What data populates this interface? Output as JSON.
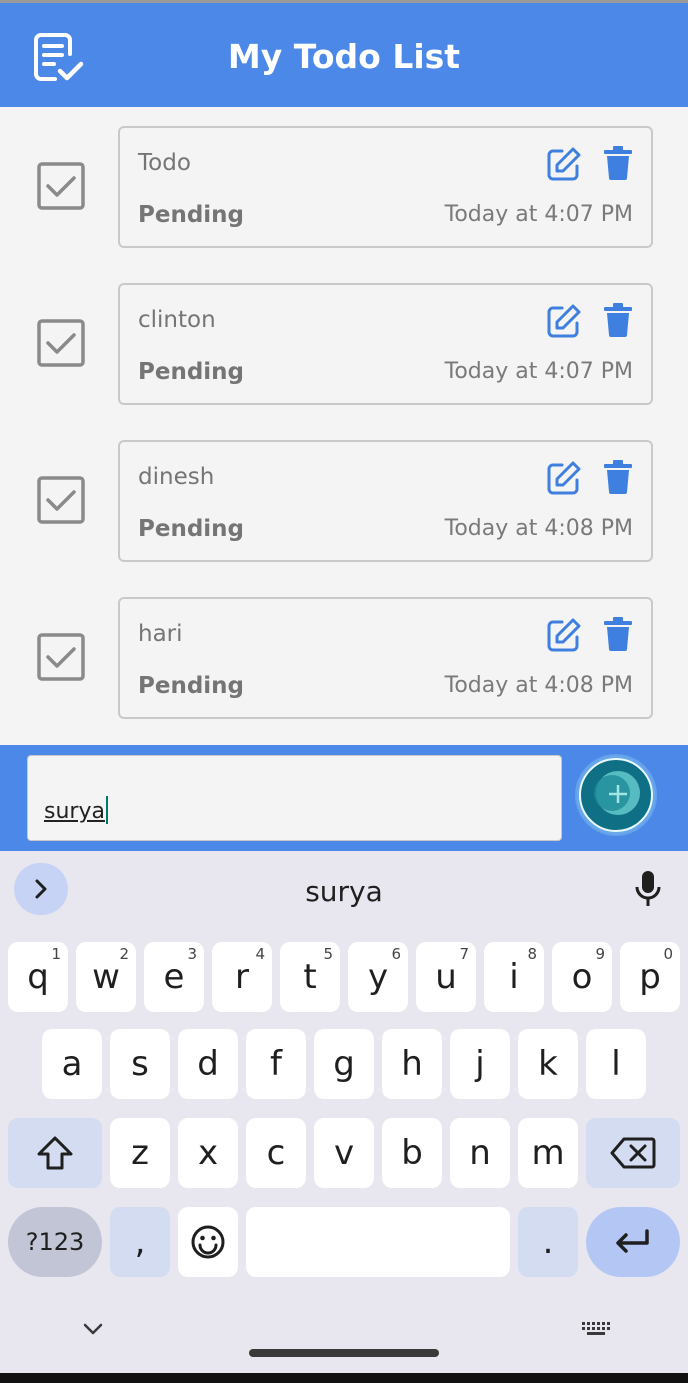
{
  "header": {
    "title": "My Todo List",
    "icon": "checklist-icon"
  },
  "todos": [
    {
      "name": "Todo",
      "status": "Pending",
      "time": "Today at 4:07 PM"
    },
    {
      "name": "clinton",
      "status": "Pending",
      "time": "Today at 4:07 PM"
    },
    {
      "name": "dinesh",
      "status": "Pending",
      "time": "Today at 4:08 PM"
    },
    {
      "name": "hari",
      "status": "Pending",
      "time": "Today at 4:08 PM"
    }
  ],
  "input": {
    "value": "surya"
  },
  "keyboard": {
    "suggestion": "surya",
    "row1": [
      {
        "key": "q",
        "hint": "1"
      },
      {
        "key": "w",
        "hint": "2"
      },
      {
        "key": "e",
        "hint": "3"
      },
      {
        "key": "r",
        "hint": "4"
      },
      {
        "key": "t",
        "hint": "5"
      },
      {
        "key": "y",
        "hint": "6"
      },
      {
        "key": "u",
        "hint": "7"
      },
      {
        "key": "i",
        "hint": "8"
      },
      {
        "key": "o",
        "hint": "9"
      },
      {
        "key": "p",
        "hint": "0"
      }
    ],
    "row2": [
      "a",
      "s",
      "d",
      "f",
      "g",
      "h",
      "j",
      "k",
      "l"
    ],
    "row3": [
      "z",
      "x",
      "c",
      "v",
      "b",
      "n",
      "m"
    ],
    "symbols_label": "?123",
    "comma": ",",
    "period": "."
  },
  "colors": {
    "header": "#4b88e8",
    "icon_blue": "#3f7fe0",
    "check_gray": "#8a8a8a"
  }
}
